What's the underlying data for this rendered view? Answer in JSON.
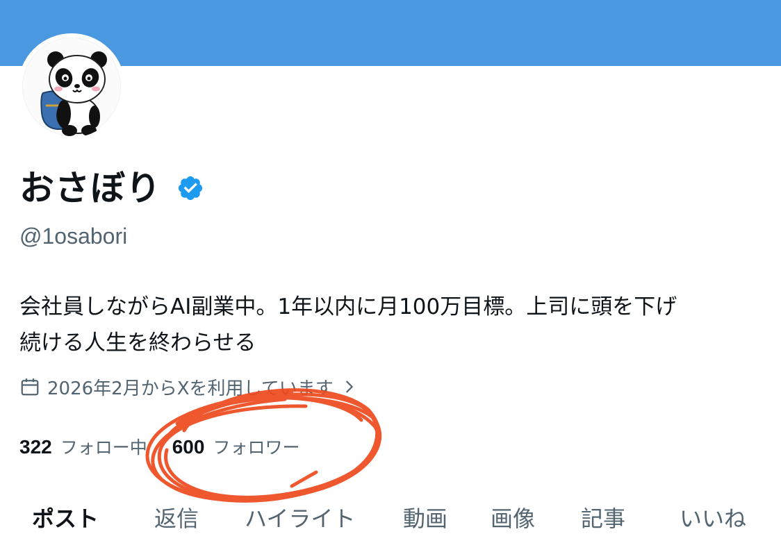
{
  "profile": {
    "display_name": "おさぼり",
    "handle": "@1osabori",
    "verified": true,
    "bio_lines": [
      "会社員しながらAI副業中。1年以内に月100万目標。上司に頭を下げ",
      "続ける人生を終わらせる"
    ],
    "joined": "2026年2月からXを利用しています",
    "following_count": "322",
    "following_label": "フォロー中",
    "followers_count": "600",
    "followers_label": "フォロワー"
  },
  "tabs": [
    {
      "label": "ポスト",
      "active": true
    },
    {
      "label": "返信",
      "active": false
    },
    {
      "label": "ハイライト",
      "active": false
    },
    {
      "label": "動画",
      "active": false
    },
    {
      "label": "画像",
      "active": false
    },
    {
      "label": "記事",
      "active": false
    },
    {
      "label": "いいね",
      "active": false
    }
  ],
  "colors": {
    "banner": "#4a99e0",
    "verified_badge": "#1d9bf0",
    "annotation_stroke": "#ee4a1e"
  },
  "icons": {
    "avatar": "panda-with-backpack",
    "verified": "verified-badge-icon",
    "joined": "calendar-icon",
    "more": "chevron-right-icon"
  }
}
